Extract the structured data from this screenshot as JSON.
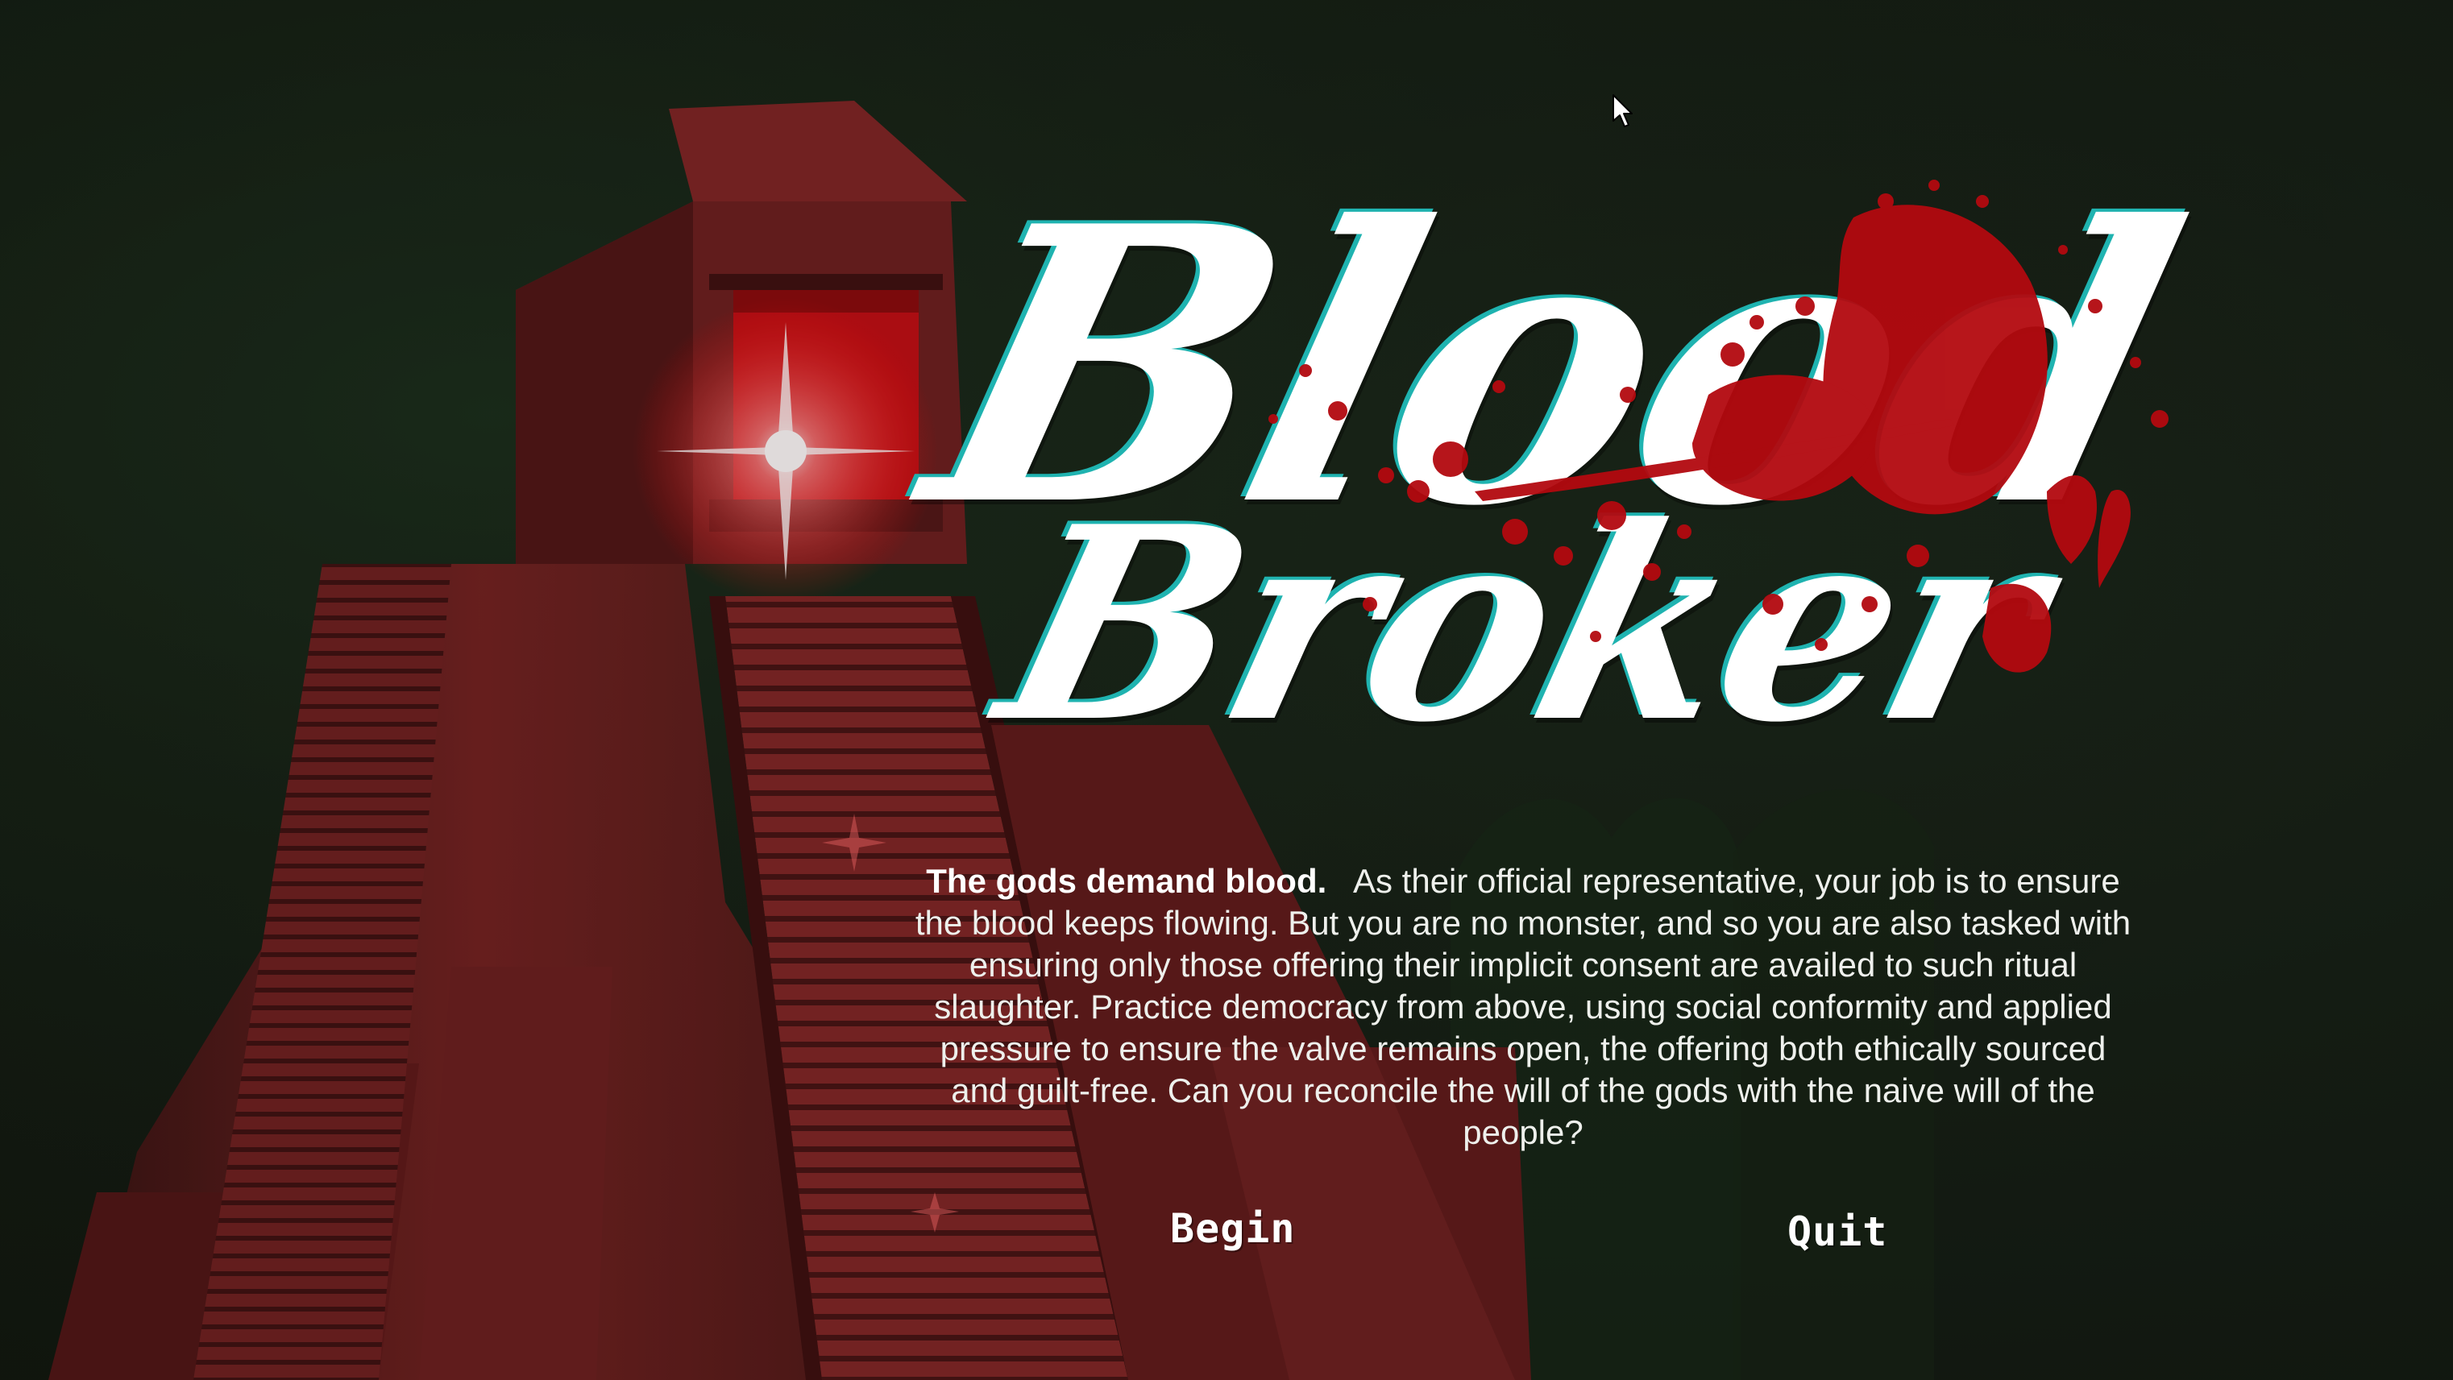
{
  "game": {
    "logo_line1": "Blood",
    "logo_line2": "Broker"
  },
  "intro": {
    "lead": "The gods demand blood.",
    "body": "As their official representative, your job is to ensure the blood keeps flowing.  But you are no monster, and so you are also tasked with ensuring only those offering their implicit consent are availed to such ritual slaughter.  Practice democracy from above, using social conformity and applied pressure to ensure the valve remains open, the offering both ethically sourced and guilt-free.  Can you reconcile the will of the gods with the naive will of the people?"
  },
  "menu": {
    "begin_label": "Begin",
    "quit_label": "Quit"
  },
  "colors": {
    "background": "#112016",
    "temple_red": "#7a1f1f",
    "temple_glow": "#e01010",
    "blood": "#b3090f",
    "logo_white": "#ffffff",
    "logo_outline": "#1fb3b0",
    "text": "#eef0ec"
  },
  "icons": {
    "cursor": "mouse-pointer-icon",
    "glow": "light-flare-icon"
  }
}
